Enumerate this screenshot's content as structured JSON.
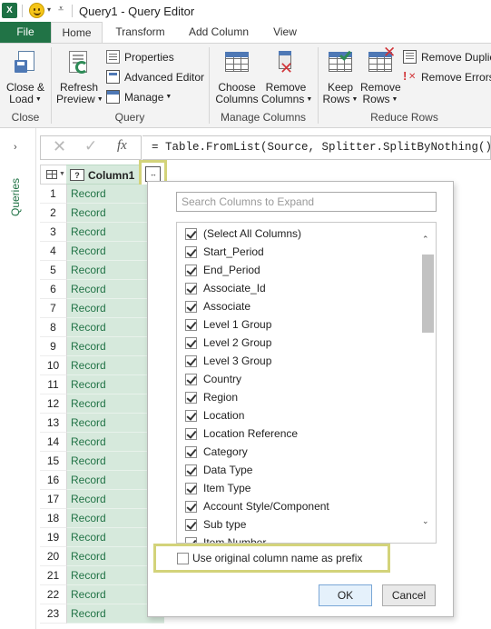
{
  "window": {
    "app_badge": "X",
    "title": "Query1 - Query Editor"
  },
  "tabs": [
    {
      "label": "File"
    },
    {
      "label": "Home"
    },
    {
      "label": "Transform"
    },
    {
      "label": "Add Column"
    },
    {
      "label": "View"
    }
  ],
  "ribbon": {
    "close_group": {
      "label": "Close",
      "close_load_line1": "Close &",
      "close_load_line2": "Load"
    },
    "query_group": {
      "label": "Query",
      "refresh_line1": "Refresh",
      "refresh_line2": "Preview",
      "properties": "Properties",
      "advanced_editor": "Advanced Editor",
      "manage": "Manage"
    },
    "manage_columns_group": {
      "label": "Manage Columns",
      "choose_line1": "Choose",
      "choose_line2": "Columns",
      "remove_line1": "Remove",
      "remove_line2": "Columns"
    },
    "reduce_rows_group": {
      "label": "Reduce Rows",
      "keep_line1": "Keep",
      "keep_line2": "Rows",
      "remove_line1": "Remove",
      "remove_line2": "Rows",
      "remove_duplicates": "Remove Duplica",
      "remove_errors": "Remove Errors"
    }
  },
  "formula_bar": {
    "cancel_glyph": "✕",
    "confirm_glyph": "✓",
    "fx_label": "fx",
    "formula": "= Table.FromList(Source, Splitter.SplitByNothing(), null,"
  },
  "side_panel": {
    "chevron": "›",
    "label": "Queries"
  },
  "grid": {
    "column_header": "Column1",
    "column_type_glyph": "?",
    "expand_glyph": "↔",
    "rows": [
      {
        "n": "1",
        "value": "Record"
      },
      {
        "n": "2",
        "value": "Record"
      },
      {
        "n": "3",
        "value": "Record"
      },
      {
        "n": "4",
        "value": "Record"
      },
      {
        "n": "5",
        "value": "Record"
      },
      {
        "n": "6",
        "value": "Record"
      },
      {
        "n": "7",
        "value": "Record"
      },
      {
        "n": "8",
        "value": "Record"
      },
      {
        "n": "9",
        "value": "Record"
      },
      {
        "n": "10",
        "value": "Record"
      },
      {
        "n": "11",
        "value": "Record"
      },
      {
        "n": "12",
        "value": "Record"
      },
      {
        "n": "13",
        "value": "Record"
      },
      {
        "n": "14",
        "value": "Record"
      },
      {
        "n": "15",
        "value": "Record"
      },
      {
        "n": "16",
        "value": "Record"
      },
      {
        "n": "17",
        "value": "Record"
      },
      {
        "n": "18",
        "value": "Record"
      },
      {
        "n": "19",
        "value": "Record"
      },
      {
        "n": "20",
        "value": "Record"
      },
      {
        "n": "21",
        "value": "Record"
      },
      {
        "n": "22",
        "value": "Record"
      },
      {
        "n": "23",
        "value": "Record"
      }
    ]
  },
  "expand_panel": {
    "search_placeholder": "Search Columns to Expand",
    "columns": [
      {
        "label": "(Select All Columns)",
        "checked": true
      },
      {
        "label": "Start_Period",
        "checked": true
      },
      {
        "label": "End_Period",
        "checked": true
      },
      {
        "label": "Associate_Id",
        "checked": true
      },
      {
        "label": "Associate",
        "checked": true
      },
      {
        "label": "Level 1 Group",
        "checked": true
      },
      {
        "label": "Level 2 Group",
        "checked": true
      },
      {
        "label": "Level 3 Group",
        "checked": true
      },
      {
        "label": "Country",
        "checked": true
      },
      {
        "label": "Region",
        "checked": true
      },
      {
        "label": "Location",
        "checked": true
      },
      {
        "label": "Location Reference",
        "checked": true
      },
      {
        "label": "Category",
        "checked": true
      },
      {
        "label": "Data Type",
        "checked": true
      },
      {
        "label": "Item Type",
        "checked": true
      },
      {
        "label": "Account Style/Component",
        "checked": true
      },
      {
        "label": "Sub type",
        "checked": true
      },
      {
        "label": "Item Number",
        "checked": true
      }
    ],
    "prefix_option": {
      "label": "Use original column name as prefix",
      "checked": false
    },
    "ok_label": "OK",
    "cancel_label": "Cancel"
  },
  "colors": {
    "excel_green": "#217346",
    "column_fill": "#d6e9dc",
    "highlight_border": "#d3d37a"
  }
}
